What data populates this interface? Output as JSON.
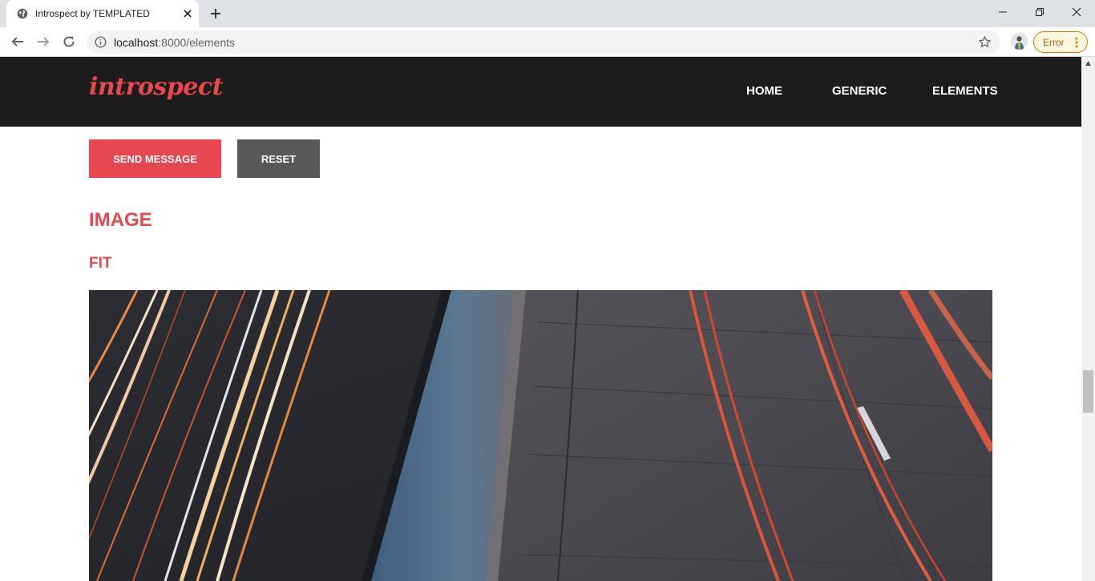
{
  "browser": {
    "tab_title": "Introspect by TEMPLATED",
    "url_host": "localhost",
    "url_rest": ":8000/elements",
    "error_label": "Error"
  },
  "site": {
    "logo": "introspect",
    "nav": [
      "HOME",
      "GENERIC",
      "ELEMENTS"
    ]
  },
  "form": {
    "send_label": "SEND MESSAGE",
    "reset_label": "RESET"
  },
  "content": {
    "heading": "IMAGE",
    "subheading": "FIT"
  },
  "colors": {
    "accent": "#e7474e",
    "header_bg": "#1c1c1c",
    "reset_bg": "#585858"
  },
  "icons": [
    "globe-icon",
    "close-icon",
    "plus-icon",
    "back-arrow-icon",
    "forward-arrow-icon",
    "reload-icon",
    "info-icon",
    "star-icon",
    "more-vert-icon"
  ]
}
